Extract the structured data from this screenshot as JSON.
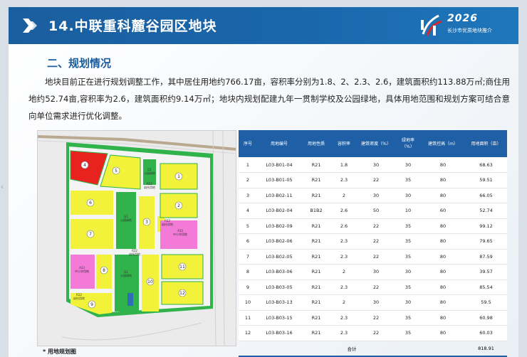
{
  "header": {
    "title": "14.中联重科麓谷园区地块",
    "logo_year": "2026",
    "logo_subtitle": "长沙市优质地块推介"
  },
  "section": {
    "title": "二、规划情况",
    "paragraph": "地块目前正在进行规划调整工作，其中居住用地约766.17亩，容积率分别为1.8、2、2.3、2.6，建筑面积约113.88万㎡;商住用地约52.74亩,容积率为2.6，建筑面积约9.14万㎡；地块内规划配建九年一贯制学校及公园绿地，具体用地范围和规划方案可结合意向单位需求进行优化调整。"
  },
  "map": {
    "caption": "* 用地规划图",
    "parcel_labels": [
      "1",
      "2",
      "3",
      "4",
      "5",
      "6",
      "7",
      "8",
      "9",
      "10",
      "11",
      "12"
    ],
    "zone_labels": {
      "g1": "G1",
      "g1_sub": "公园绿地",
      "r22": "R22",
      "r22_sub": "幼托用地",
      "a33": "A33",
      "a33_sub": "中小学用地"
    },
    "colors": {
      "residential": "#f2f23a",
      "commercial": "#e8231f",
      "green": "#2fb34a",
      "school": "#f47ad8",
      "road": "#f5f5f5"
    }
  },
  "table": {
    "headers": [
      "序号",
      "用地编号",
      "用地性质",
      "容积率",
      "建筑密度（%）",
      "绿地率（%）",
      "建筑控高（m）",
      "用地面积（亩）"
    ],
    "rows": [
      [
        "1",
        "L03-B01-04",
        "R21",
        "1.8",
        "30",
        "30",
        "80",
        "68.63"
      ],
      [
        "2",
        "L03-B01-05",
        "R21",
        "2.3",
        "22",
        "35",
        "80",
        "59.51"
      ],
      [
        "3",
        "L03-B02-11",
        "R21",
        "2",
        "30",
        "30",
        "80",
        "66.05"
      ],
      [
        "4",
        "L03-B02-04",
        "B1B2",
        "2.6",
        "50",
        "10",
        "60",
        "52.74"
      ],
      [
        "5",
        "L03-B02-09",
        "R21",
        "2.6",
        "22",
        "35",
        "80",
        "99.12"
      ],
      [
        "6",
        "L03-B02-06",
        "R21",
        "2.3",
        "22",
        "35",
        "80",
        "79.65"
      ],
      [
        "7",
        "L03-B02-05",
        "R21",
        "2.3",
        "22",
        "35",
        "80",
        "87.59"
      ],
      [
        "8",
        "L03-B03-06",
        "R21",
        "2",
        "30",
        "30",
        "80",
        "39.57"
      ],
      [
        "9",
        "L03-B03-05",
        "R21",
        "2.3",
        "22",
        "35",
        "80",
        "85.54"
      ],
      [
        "10",
        "L03-B03-13",
        "R21",
        "2",
        "30",
        "30",
        "80",
        "59.5"
      ],
      [
        "11",
        "L03-B03-15",
        "R21",
        "2.3",
        "22",
        "35",
        "80",
        "60.98"
      ],
      [
        "12",
        "L03-B03-16",
        "R21",
        "2.3",
        "22",
        "35",
        "80",
        "60.03"
      ]
    ],
    "total_label": "合计",
    "total_value": "818.91"
  },
  "colors": {
    "header_blue": "#1a67ac",
    "table_header": "#1f5fa6",
    "accent_red": "#d8262c"
  }
}
